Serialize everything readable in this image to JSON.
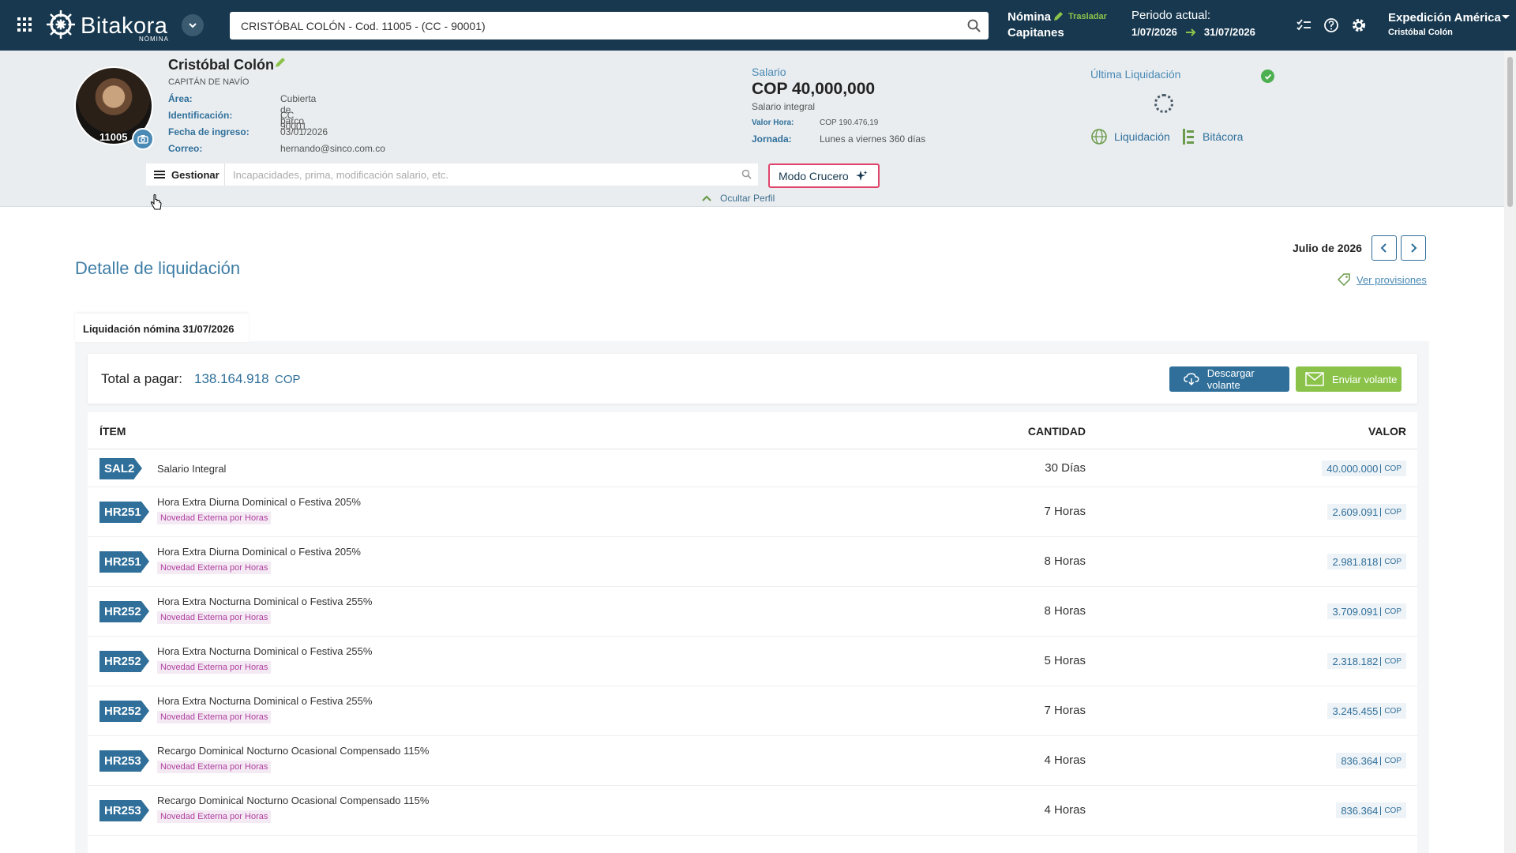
{
  "app": {
    "logo_text": "Bitakora",
    "logo_sub": "NÓMINA"
  },
  "topbar": {
    "search_value": "CRISTÓBAL COLÓN - Cod. 11005 - (CC - 90001)",
    "module": "Nómina",
    "module_sub": "Capitanes",
    "trasladar": "Trasladar",
    "periodo_label": "Periodo actual:",
    "periodo_start": "1/07/2026",
    "periodo_end": "31/07/2026",
    "company": "Expedición América",
    "user": "Cristóbal Colón"
  },
  "profile": {
    "code": "11005",
    "name": "Cristóbal Colón",
    "role": "CAPITÁN DE NAVÍO",
    "fields": [
      {
        "label": "Área:",
        "value": "Cubierta de barco"
      },
      {
        "label": "Identificación:",
        "value": "CC 90001"
      },
      {
        "label": "Fecha de ingreso:",
        "value": "03/01/2026"
      },
      {
        "label": "Correo:",
        "value": "hernando@sinco.com.co"
      }
    ],
    "salario_label": "Salario",
    "salario_value": "COP 40,000,000",
    "salario_type": "Salario integral",
    "valor_hora_label": "Valor Hora:",
    "valor_hora": "COP 190.476,19",
    "jornada_label": "Jornada:",
    "jornada": "Lunes a viernes 360 días",
    "ultima_liq": "Última Liquidación",
    "link_liquidacion": "Liquidación",
    "link_bitacora": "Bitácora",
    "gestionar": "Gestionar",
    "gestionar_placeholder": "Incapacidades, prima, modificación salario, etc.",
    "modo_crucero": "Modo Crucero",
    "ocultar": "Ocultar Perfil"
  },
  "main": {
    "title": "Detalle de liquidación",
    "month": "Julio de 2026",
    "ver_provisiones": "Ver provisiones",
    "tab": "Liquidación nómina 31/07/2026",
    "total_label": "Total a pagar:",
    "total_value": "138.164.918",
    "total_currency": "COP",
    "btn_descargar": "Descargar volante",
    "btn_enviar": "Enviar volante",
    "col_item": "ÍTEM",
    "col_cantidad": "CANTIDAD",
    "col_valor": "VALOR",
    "rows": [
      {
        "code": "SAL2",
        "desc": "Salario Integral",
        "tag": "",
        "qty": "30  Días",
        "amount": "40.000.000",
        "cur": "COP"
      },
      {
        "code": "HR251",
        "desc": "Hora Extra Diurna Dominical o Festiva 205%",
        "tag": "Novedad Externa por Horas",
        "qty": "7  Horas",
        "amount": "2.609.091",
        "cur": "COP"
      },
      {
        "code": "HR251",
        "desc": "Hora Extra Diurna Dominical o Festiva 205%",
        "tag": "Novedad Externa por Horas",
        "qty": "8  Horas",
        "amount": "2.981.818",
        "cur": "COP"
      },
      {
        "code": "HR252",
        "desc": "Hora Extra Nocturna Dominical o Festiva 255%",
        "tag": "Novedad Externa por Horas",
        "qty": "8  Horas",
        "amount": "3.709.091",
        "cur": "COP"
      },
      {
        "code": "HR252",
        "desc": "Hora Extra Nocturna Dominical o Festiva 255%",
        "tag": "Novedad Externa por Horas",
        "qty": "5  Horas",
        "amount": "2.318.182",
        "cur": "COP"
      },
      {
        "code": "HR252",
        "desc": "Hora Extra Nocturna Dominical o Festiva 255%",
        "tag": "Novedad Externa por Horas",
        "qty": "7  Horas",
        "amount": "3.245.455",
        "cur": "COP"
      },
      {
        "code": "HR253",
        "desc": "Recargo Dominical Nocturno Ocasional Compensado 115%",
        "tag": "Novedad Externa por Horas",
        "qty": "4  Horas",
        "amount": "836.364",
        "cur": "COP"
      },
      {
        "code": "HR253",
        "desc": "Recargo Dominical Nocturno Ocasional Compensado 115%",
        "tag": "Novedad Externa por Horas",
        "qty": "4  Horas",
        "amount": "836.364",
        "cur": "COP"
      }
    ]
  },
  "colors": {
    "topbar": "#17384f",
    "accent": "#2f6f9a",
    "green": "#8bc34a",
    "tag": "#b040a0"
  }
}
